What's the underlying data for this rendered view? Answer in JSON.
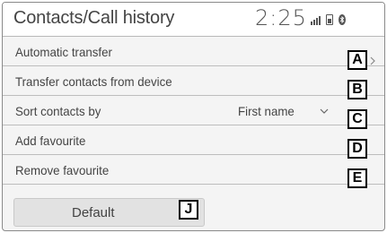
{
  "header": {
    "title": "Contacts/Call history",
    "clock": "2:25",
    "status_icons": [
      "signal-bars-icon",
      "battery-icon",
      "bluetooth-icon"
    ]
  },
  "settings": {
    "items": [
      {
        "label": "Automatic transfer",
        "callout": "A"
      },
      {
        "label": "Transfer contacts from device",
        "callout": "B"
      },
      {
        "label": "Sort contacts by",
        "value": "First name",
        "callout": "C"
      },
      {
        "label": "Add favourite",
        "callout": "D"
      },
      {
        "label": "Remove favourite",
        "callout": "E"
      }
    ]
  },
  "footer": {
    "default_label": "Default",
    "default_callout": "J"
  },
  "colors": {
    "panel_bg": "#f4f4f4",
    "header_bg": "#ffffff",
    "divider": "#bdbdbd",
    "text": "#444444"
  }
}
